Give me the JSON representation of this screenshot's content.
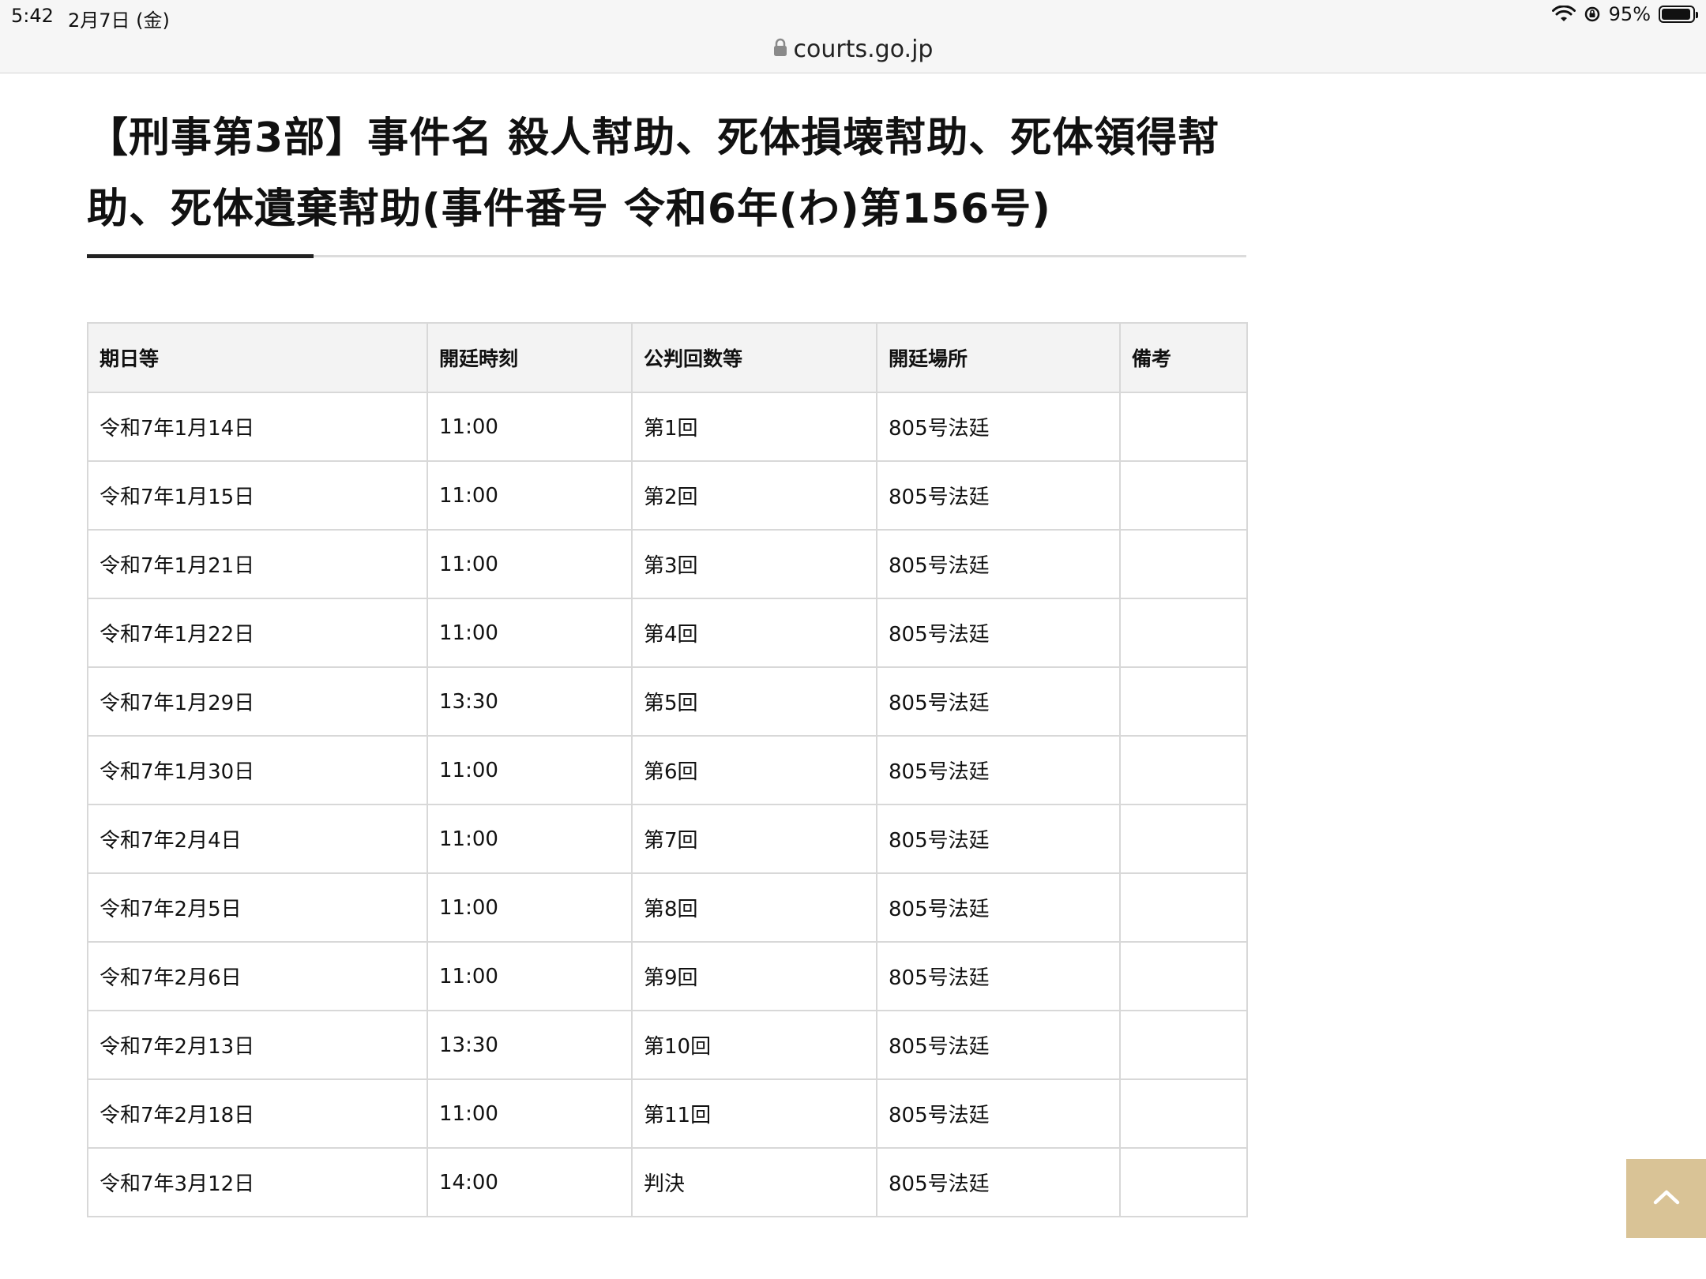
{
  "status_bar": {
    "time": "5:42",
    "date": "2月7日 (金)",
    "battery": "95%",
    "battery_level": 0.95
  },
  "browser": {
    "url": "courts.go.jp"
  },
  "page": {
    "title": "【刑事第3部】事件名 殺人幇助、死体損壊幇助、死体領得幇助、死体遺棄幇助(事件番号 令和6年(わ)第156号)"
  },
  "table": {
    "headers": [
      "期日等",
      "開廷時刻",
      "公判回数等",
      "開廷場所",
      "備考"
    ],
    "rows": [
      [
        "令和7年1月14日",
        "11:00",
        "第1回",
        "805号法廷",
        ""
      ],
      [
        "令和7年1月15日",
        "11:00",
        "第2回",
        "805号法廷",
        ""
      ],
      [
        "令和7年1月21日",
        "11:00",
        "第3回",
        "805号法廷",
        ""
      ],
      [
        "令和7年1月22日",
        "11:00",
        "第4回",
        "805号法廷",
        ""
      ],
      [
        "令和7年1月29日",
        "13:30",
        "第5回",
        "805号法廷",
        ""
      ],
      [
        "令和7年1月30日",
        "11:00",
        "第6回",
        "805号法廷",
        ""
      ],
      [
        "令和7年2月4日",
        "11:00",
        "第7回",
        "805号法廷",
        ""
      ],
      [
        "令和7年2月5日",
        "11:00",
        "第8回",
        "805号法廷",
        ""
      ],
      [
        "令和7年2月6日",
        "11:00",
        "第9回",
        "805号法廷",
        ""
      ],
      [
        "令和7年2月13日",
        "13:30",
        "第10回",
        "805号法廷",
        ""
      ],
      [
        "令和7年2月18日",
        "11:00",
        "第11回",
        "805号法廷",
        ""
      ],
      [
        "令和7年3月12日",
        "14:00",
        "判決",
        "805号法廷",
        ""
      ]
    ]
  },
  "colors": {
    "accent": "#d9c396",
    "header_bg": "#f3f3f3",
    "border": "#d8d8d8"
  },
  "icons": {
    "lock": "lock-icon",
    "wifi": "wifi-icon",
    "orientation_lock": "orientation-lock-icon",
    "battery": "battery-icon",
    "scroll_top": "chevron-up-icon"
  }
}
